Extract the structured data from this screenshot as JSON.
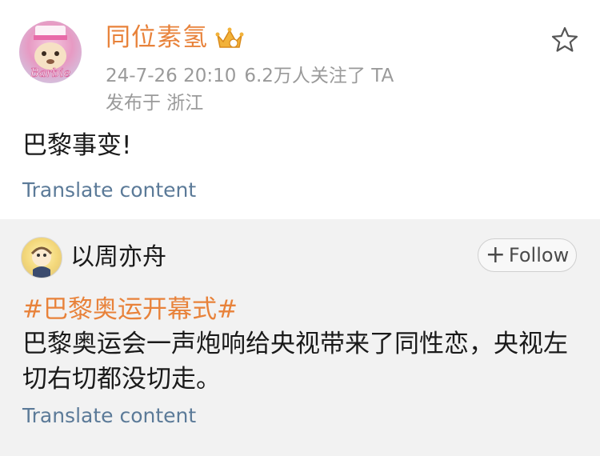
{
  "post": {
    "author": "同位素氢",
    "date": "24-7-26 20:10",
    "followers": "6.2万人关注了 TA",
    "location": "发布于 浙江",
    "text": "巴黎事变!",
    "translate_label": "Translate content",
    "avatar_text": "Barbie",
    "icons": [
      "crown-icon",
      "star-icon"
    ]
  },
  "repost": {
    "author": "以周亦舟",
    "follow_label": "Follow",
    "hashtag": "#巴黎奥运开幕式#",
    "text": "巴黎奥运会一声炮响给央视带来了同性恋，央视左切右切都没切走。",
    "translate_label": "Translate content"
  },
  "colors": {
    "accent": "#e8823a",
    "link": "#5b7a98",
    "meta": "#9a9a9a",
    "repost_bg": "#f2f2f2"
  }
}
